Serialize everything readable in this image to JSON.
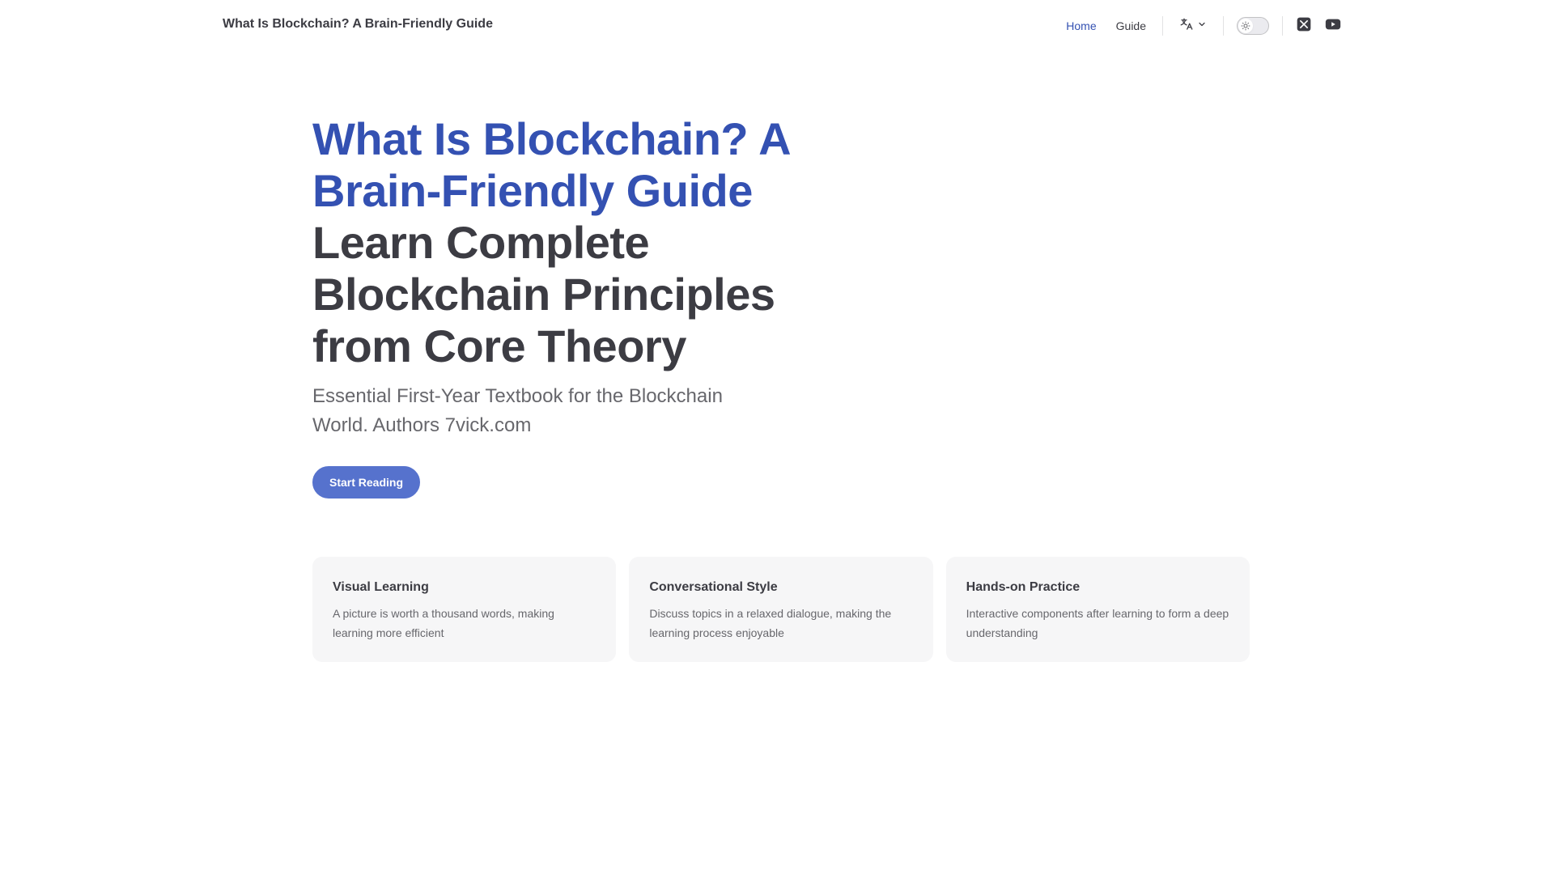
{
  "nav": {
    "site_title": "What Is Blockchain? A Brain-Friendly Guide",
    "links": [
      {
        "label": "Home",
        "active": true
      },
      {
        "label": "Guide",
        "active": false
      }
    ],
    "icons": {
      "language": "language-icon",
      "chevron": "chevron-down-icon",
      "theme_toggle": "sun-icon",
      "twitter": "x-twitter-icon",
      "youtube": "youtube-icon"
    }
  },
  "hero": {
    "name": "What Is Blockchain? A Brain-Friendly Guide",
    "text": "Learn Complete Blockchain Principles from Core Theory",
    "tagline": "Essential First-Year Textbook for the Blockchain World. Authors 7vick.com",
    "action_label": "Start Reading"
  },
  "features": [
    {
      "title": "Visual Learning",
      "details": "A picture is worth a thousand words, making learning more efficient"
    },
    {
      "title": "Conversational Style",
      "details": "Discuss topics in a relaxed dialogue, making the learning process enjoyable"
    },
    {
      "title": "Hands-on Practice",
      "details": "Interactive components after learning to form a deep understanding"
    }
  ],
  "colors": {
    "brand": "#3451b2",
    "button": "#5672cd",
    "text": "#3c3c43",
    "muted": "#67676c",
    "card_bg": "#f6f6f7"
  }
}
